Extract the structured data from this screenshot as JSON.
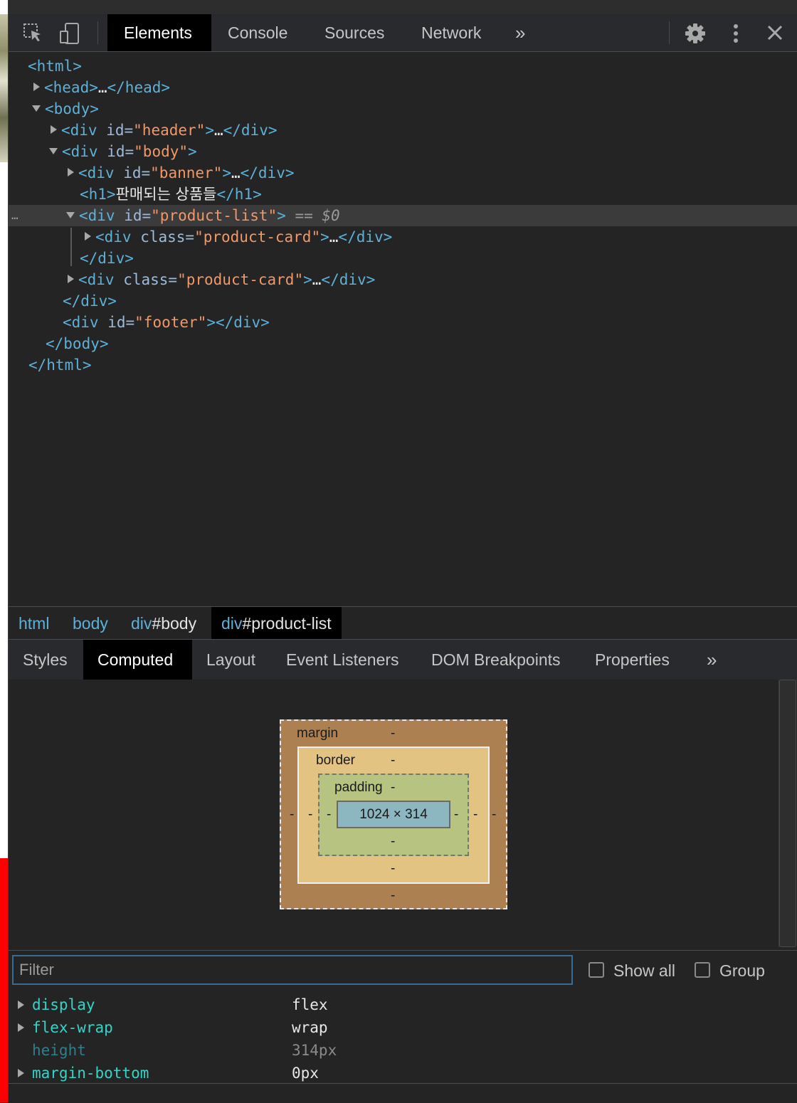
{
  "toolbar": {
    "tabs": [
      "Elements",
      "Console",
      "Sources",
      "Network"
    ],
    "more": "»",
    "icons": [
      "inspect-element-icon",
      "device-toggle-icon",
      "settings-gear-icon",
      "kebab-menu-icon",
      "close-icon"
    ]
  },
  "dom": {
    "l1": "<html>",
    "l2a": "<head>",
    "l2b": "…",
    "l2c": "</head>",
    "l3": "<body>",
    "l4_open": "<div",
    "l4_an": " id=",
    "l4_av": "\"header\"",
    "l4_close": ">",
    "l4_dots": "…",
    "l4_end": "</div>",
    "l5_open": "<div",
    "l5_an": " id=",
    "l5_av": "\"body\"",
    "l5_close": ">",
    "l6_open": "<div",
    "l6_an": " id=",
    "l6_av": "\"banner\"",
    "l6_close": ">",
    "l6_dots": "…",
    "l6_end": "</div>",
    "l7_open": "<h1>",
    "l7_text": "판매되는 상품들",
    "l7_end": "</h1>",
    "l8_open": "<div",
    "l8_an": " id=",
    "l8_av": "\"product-list\"",
    "l8_close": ">",
    "l8_eq": " == ",
    "l8_dollar": "$0",
    "l8_dots": "…",
    "l9_open": "<div",
    "l9_an": " class=",
    "l9_av": "\"product-card\"",
    "l9_close": ">",
    "l9_dots": "…",
    "l9_end": "</div>",
    "l10": "</div>",
    "l11_open": "<div",
    "l11_an": " class=",
    "l11_av": "\"product-card\"",
    "l11_close": ">",
    "l11_dots": "…",
    "l11_end": "</div>",
    "l12": "</div>",
    "l13_open": "<div",
    "l13_an": " id=",
    "l13_av": "\"footer\"",
    "l13_close": "></div>",
    "l14": "</body>",
    "l15": "</html>"
  },
  "breadcrumb": [
    {
      "tag": "html",
      "rest": ""
    },
    {
      "tag": "body",
      "rest": ""
    },
    {
      "tag": "div",
      "rest": "#body"
    },
    {
      "tag": "div",
      "rest": "#product-list"
    }
  ],
  "subtabs": [
    "Styles",
    "Computed",
    "Layout",
    "Event Listeners",
    "DOM Breakpoints",
    "Properties"
  ],
  "subtabs_more": "»",
  "boxmodel": {
    "margin_label": "margin",
    "border_label": "border",
    "padding_label": "padding",
    "dash": "-",
    "content": "1024 × 314"
  },
  "filter": {
    "placeholder": "Filter",
    "show_all": "Show all",
    "group": "Group"
  },
  "computed": [
    {
      "name": "display",
      "value": "flex"
    },
    {
      "name": "flex-wrap",
      "value": "wrap"
    },
    {
      "name": "height",
      "value": "314px"
    },
    {
      "name": "margin-bottom",
      "value": "0px"
    }
  ]
}
